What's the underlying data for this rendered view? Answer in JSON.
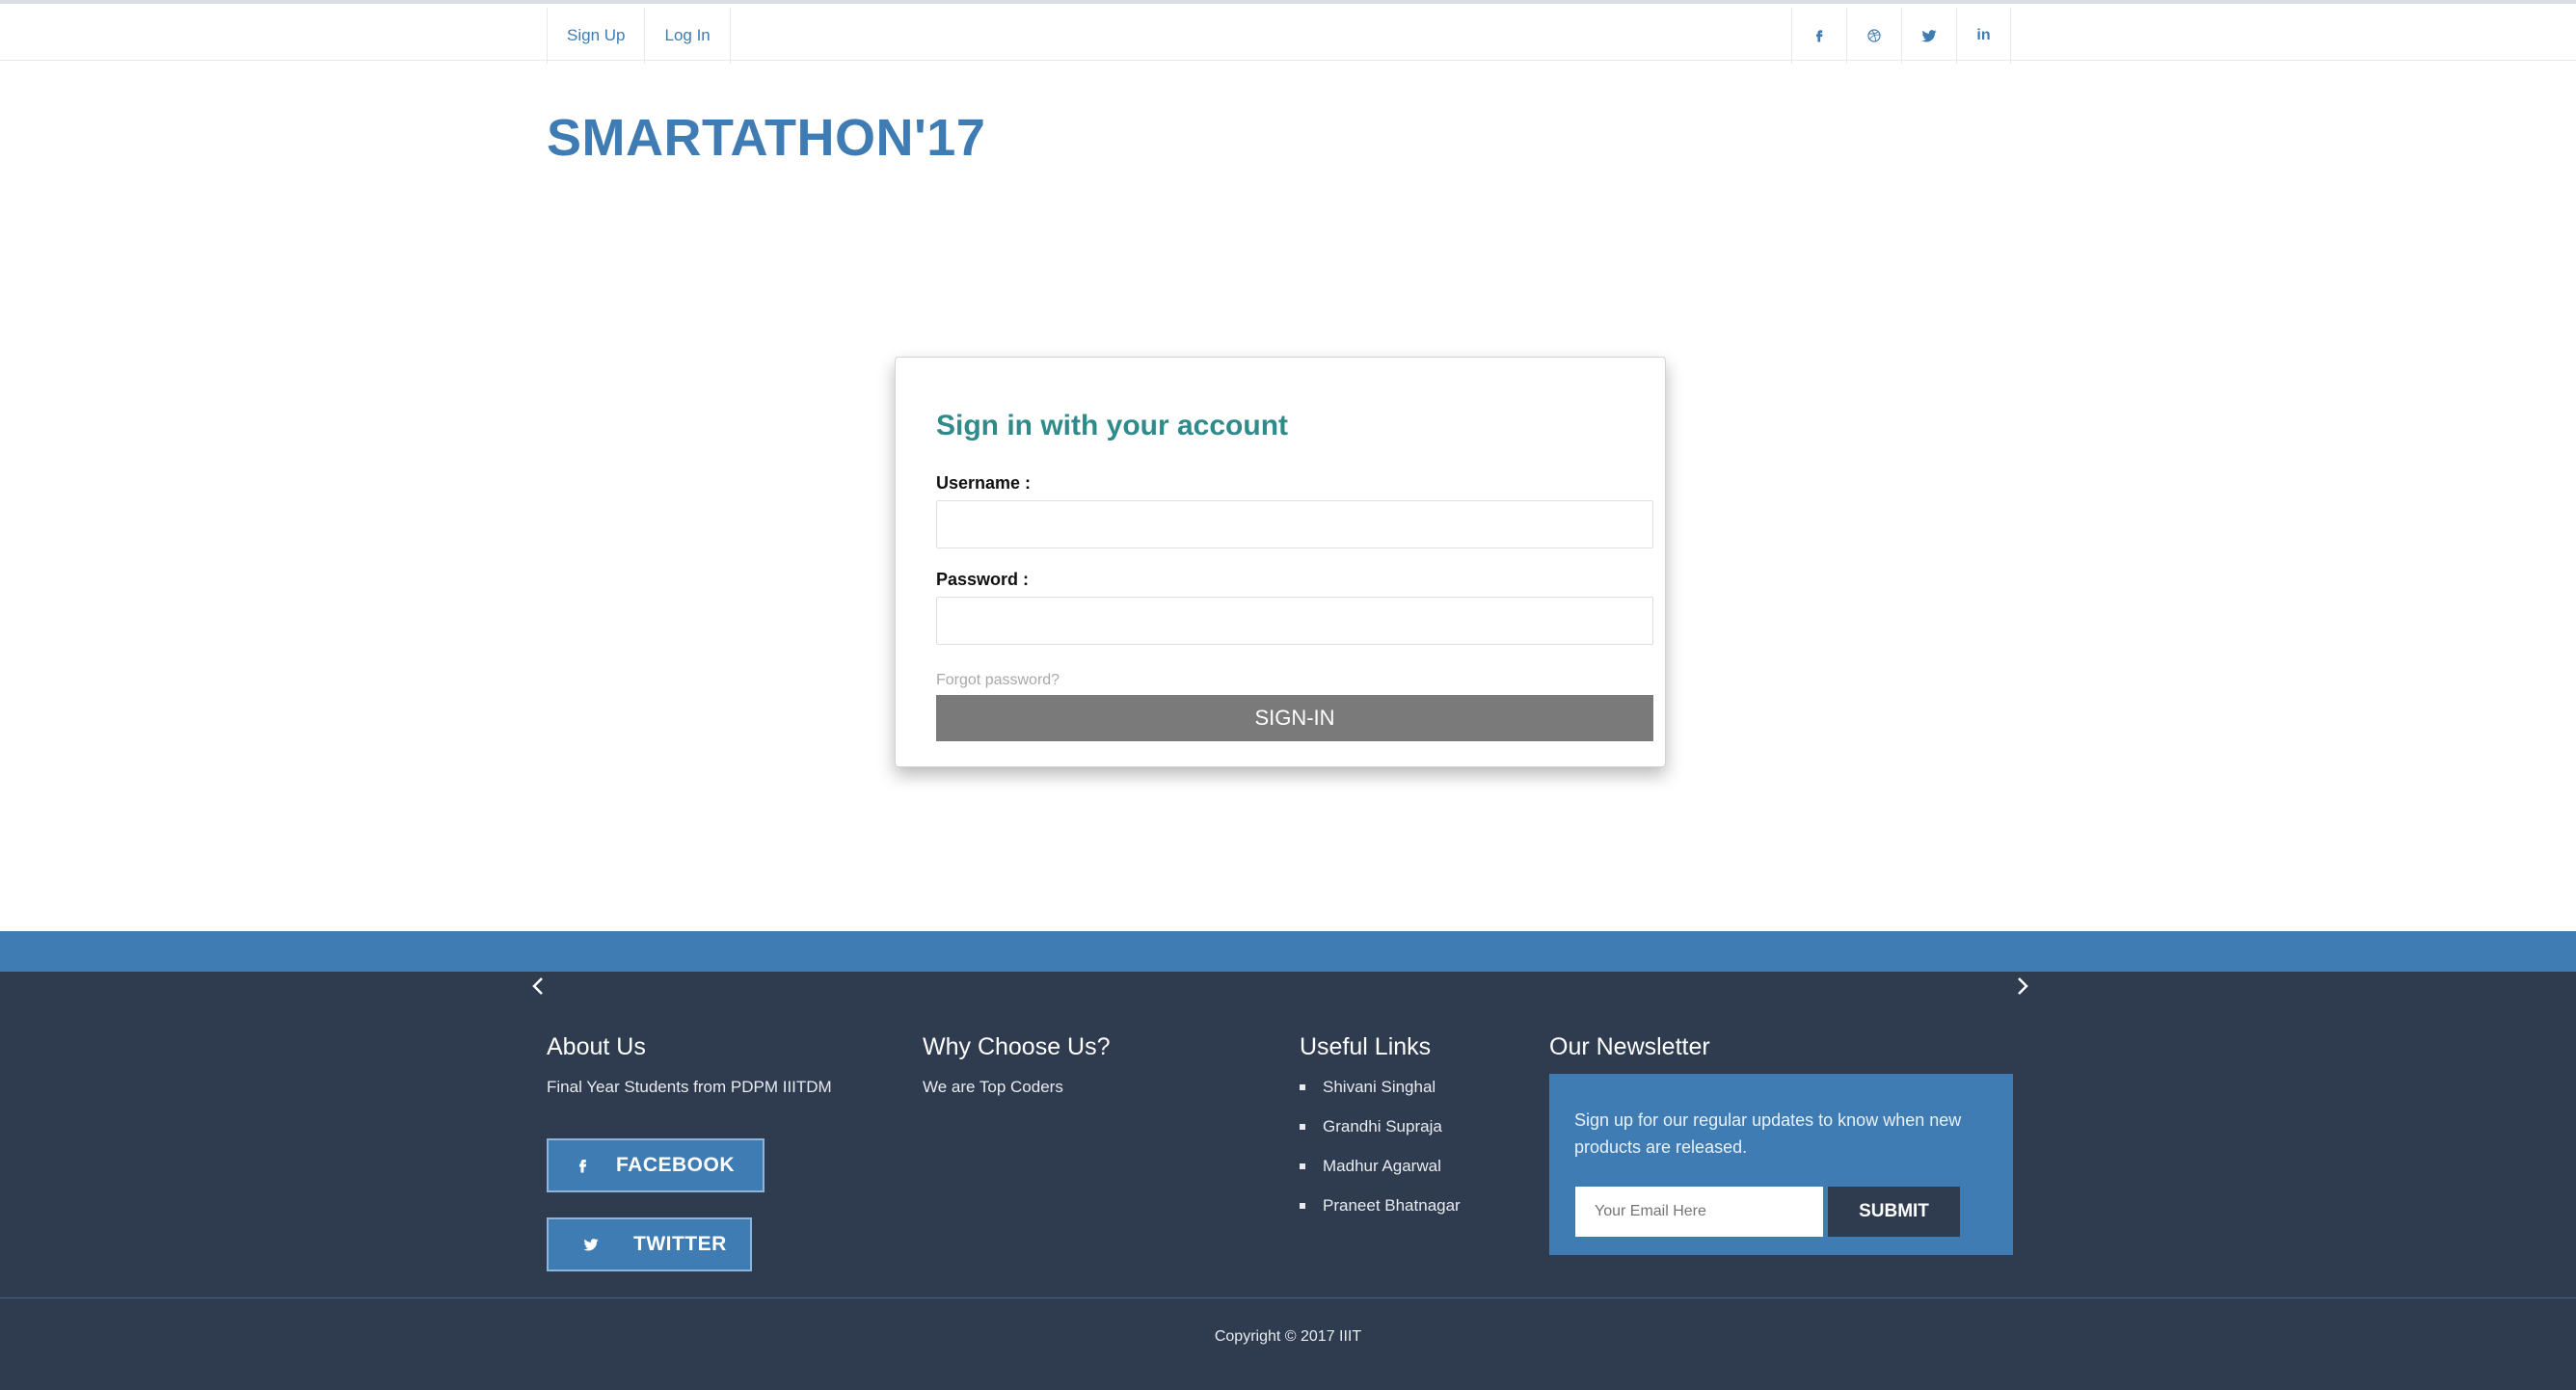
{
  "topnav": {
    "signup_label": "Sign Up",
    "login_label": "Log In"
  },
  "social_icons": [
    "facebook-icon",
    "dribbble-icon",
    "twitter-icon",
    "linkedin-icon"
  ],
  "social_text": {
    "linkedin": "in"
  },
  "brand": "SMARTATHON'17",
  "login": {
    "title": "Sign in with your account",
    "username_label": "Username :",
    "username_value": "",
    "password_label": "Password :",
    "password_value": "",
    "forgot_label": "Forgot password?",
    "signin_label": "SIGN-IN"
  },
  "footer": {
    "about": {
      "heading": "About Us",
      "text": "Final Year Students from PDPM IIITDM"
    },
    "why": {
      "heading": "Why Choose Us?",
      "text": "We are Top Coders"
    },
    "links": {
      "heading": "Useful Links",
      "items": [
        "Shivani Singhal",
        "Grandhi Supraja",
        "Madhur Agarwal",
        "Praneet Bhatnagar"
      ]
    },
    "newsletter": {
      "heading": "Our Newsletter",
      "text": "Sign up for our regular updates to know when new products are released.",
      "email_placeholder": "Your Email Here",
      "submit_label": "SUBMIT"
    },
    "facebook_label": "FACEBOOK",
    "twitter_label": "TWITTER",
    "copyright": "Copyright © 2017 IIIT"
  },
  "colors": {
    "brand_blue": "#3f7cb3",
    "footer_bg": "#2f3b4e",
    "title_teal": "#2f8a8a",
    "button_gray": "#7a7a7a"
  }
}
